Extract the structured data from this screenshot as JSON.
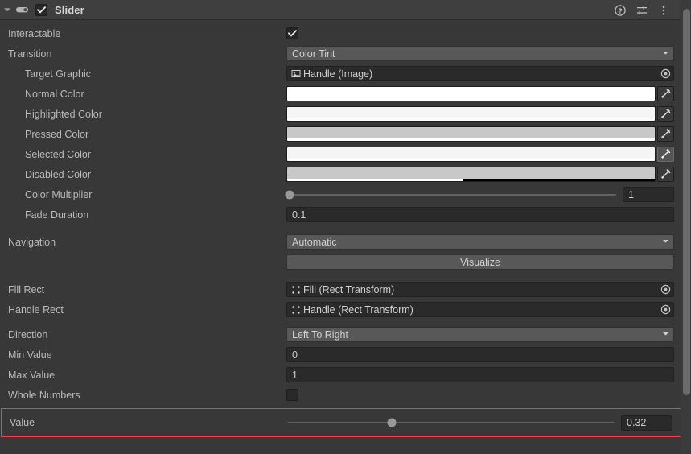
{
  "header": {
    "foldout_icon": "foldout-arrow-down-icon",
    "eye_icon": "component-toggle-eye-icon",
    "enabled_checked": true,
    "title": "Slider",
    "icons": [
      {
        "name": "help-icon",
        "glyph": "?"
      },
      {
        "name": "preset-icon",
        "glyph": "preset"
      },
      {
        "name": "kebab-menu-icon",
        "glyph": "⋮"
      }
    ]
  },
  "rows": {
    "interactable": {
      "label": "Interactable",
      "checked": true
    },
    "transition": {
      "label": "Transition",
      "value": "Color Tint"
    },
    "target_graphic": {
      "label": "Target Graphic",
      "value": "Handle (Image)",
      "icon": "image-component-icon"
    },
    "normal_color": {
      "label": "Normal Color",
      "color": "#FFFFFF",
      "alpha_pct": 100
    },
    "highlighted_color": {
      "label": "Highlighted Color",
      "color": "#F5F5F5",
      "alpha_pct": 100
    },
    "pressed_color": {
      "label": "Pressed Color",
      "color": "#C8C8C8",
      "alpha_pct": 100
    },
    "selected_color": {
      "label": "Selected Color",
      "color": "#F5F5F5",
      "alpha_pct": 100
    },
    "disabled_color": {
      "label": "Disabled Color",
      "color": "#C8C8C8",
      "alpha_pct": 48
    },
    "color_multiplier": {
      "label": "Color Multiplier",
      "value": "1",
      "knob_pct": 1
    },
    "fade_duration": {
      "label": "Fade Duration",
      "value": "0.1"
    },
    "navigation": {
      "label": "Navigation",
      "value": "Automatic"
    },
    "visualize": {
      "label": "Visualize"
    },
    "fill_rect": {
      "label": "Fill Rect",
      "value": "Fill (Rect Transform)",
      "icon": "rect-transform-icon"
    },
    "handle_rect": {
      "label": "Handle Rect",
      "value": "Handle (Rect Transform)",
      "icon": "rect-transform-icon"
    },
    "direction": {
      "label": "Direction",
      "value": "Left To Right"
    },
    "min_value": {
      "label": "Min Value",
      "value": "0"
    },
    "max_value": {
      "label": "Max Value",
      "value": "1"
    },
    "whole_numbers": {
      "label": "Whole Numbers",
      "checked": false
    },
    "value": {
      "label": "Value",
      "value": "0.32",
      "knob_pct": 32
    }
  },
  "annotation": {
    "color": "#F1433F"
  },
  "scrollbar": {
    "thumb_top_pct": 2,
    "thumb_height_pct": 85
  }
}
